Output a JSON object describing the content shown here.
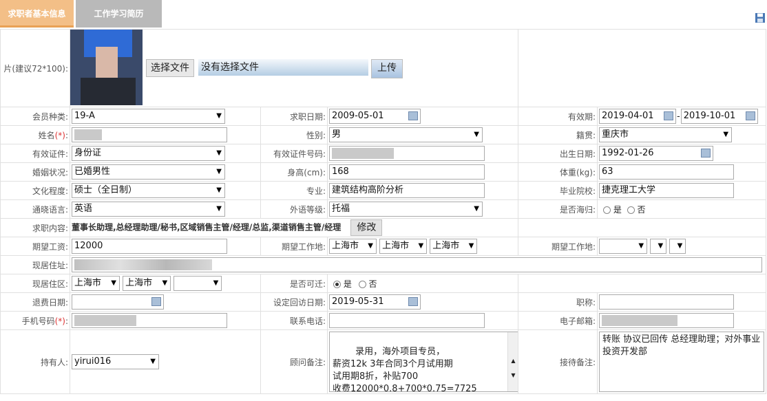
{
  "tabs": {
    "basic": "求职者基本信息",
    "work": "工作学习简历"
  },
  "photo": {
    "label": "片(建议72*100):",
    "choose_button": "选择文件",
    "no_file": "没有选择文件",
    "upload_button": "上传"
  },
  "member_type": {
    "label": "会员种类:",
    "value": "19-A"
  },
  "job_date": {
    "label": "求职日期:",
    "value": "2009-05-01"
  },
  "valid": {
    "label": "有效期:",
    "from": "2019-04-01",
    "to": "2019-10-01",
    "sep": "-"
  },
  "name": {
    "label": "姓名",
    "req": "(*)",
    "colon": ":"
  },
  "gender": {
    "label": "性别:",
    "value": "男"
  },
  "native": {
    "label": "籍贯:",
    "value": "重庆市"
  },
  "id_type": {
    "label": "有效证件:",
    "value": "身份证"
  },
  "id_no": {
    "label": "有效证件号码:"
  },
  "birth": {
    "label": "出生日期:",
    "value": "1992-01-26"
  },
  "marital": {
    "label": "婚姻状况:",
    "value": "已婚男性"
  },
  "height": {
    "label": "身高(cm):",
    "value": "168"
  },
  "weight": {
    "label": "体重(kg):",
    "value": "63"
  },
  "education": {
    "label": "文化程度:",
    "value": "硕士（全日制）"
  },
  "major": {
    "label": "专业:",
    "value": "建筑结构高阶分析"
  },
  "school": {
    "label": "毕业院校:",
    "value": "捷克理工大学"
  },
  "language": {
    "label": "通晓语言:",
    "value": "英语"
  },
  "foreign_level": {
    "label": "外语等级:",
    "value": "托福"
  },
  "returnee": {
    "label": "是否海归:",
    "yes": "是",
    "no": "否"
  },
  "job_content": {
    "label": "求职内容:",
    "value": "董事长助理,总经理助理/秘书,区域销售主管/经理/总监,渠道销售主管/经理",
    "edit_button": "修改"
  },
  "salary": {
    "label": "期望工资:",
    "value": "12000"
  },
  "work_place": {
    "label": "期望工作地:",
    "p1": "上海市",
    "p2": "上海市",
    "p3": "上海市"
  },
  "work_place2": {
    "label": "期望工作地:"
  },
  "address": {
    "label": "现居住址:"
  },
  "district": {
    "label": "现居住区:",
    "d1": "上海市",
    "d2": "上海市"
  },
  "relocate": {
    "label": "是否可迁:",
    "yes": "是",
    "no": "否"
  },
  "refund_date": {
    "label": "退费日期:"
  },
  "revisit_date": {
    "label": "设定回访日期:",
    "value": "2019-05-31"
  },
  "title": {
    "label": "职称:"
  },
  "mobile": {
    "label": "手机号码",
    "req": "(*)",
    "colon": ":"
  },
  "phone": {
    "label": "联系电话:"
  },
  "email": {
    "label": "电子邮箱:"
  },
  "owner": {
    "label": "持有人:",
    "value": "yirui016"
  },
  "advisor_note": {
    "label": "顾问备注:",
    "value": "录用，海外项目专员，\n薪资12k 3年合同3个月试用期\n试用期8折，补贴700\n收费12000*0.8+700*0.75=7725"
  },
  "reception_note": {
    "label": "接待备注:",
    "value": "转账 协议已回传 总经理助理；对外事业投资开发部"
  }
}
